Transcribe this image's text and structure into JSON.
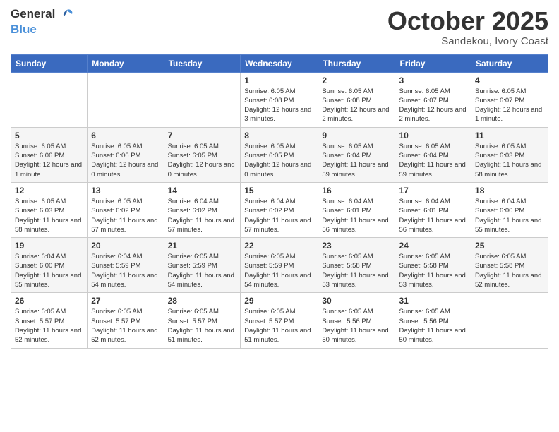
{
  "header": {
    "logo_general": "General",
    "logo_blue": "Blue",
    "month": "October 2025",
    "location": "Sandekou, Ivory Coast"
  },
  "weekdays": [
    "Sunday",
    "Monday",
    "Tuesday",
    "Wednesday",
    "Thursday",
    "Friday",
    "Saturday"
  ],
  "weeks": [
    [
      {
        "day": "",
        "info": ""
      },
      {
        "day": "",
        "info": ""
      },
      {
        "day": "",
        "info": ""
      },
      {
        "day": "1",
        "info": "Sunrise: 6:05 AM\nSunset: 6:08 PM\nDaylight: 12 hours and 3 minutes."
      },
      {
        "day": "2",
        "info": "Sunrise: 6:05 AM\nSunset: 6:08 PM\nDaylight: 12 hours and 2 minutes."
      },
      {
        "day": "3",
        "info": "Sunrise: 6:05 AM\nSunset: 6:07 PM\nDaylight: 12 hours and 2 minutes."
      },
      {
        "day": "4",
        "info": "Sunrise: 6:05 AM\nSunset: 6:07 PM\nDaylight: 12 hours and 1 minute."
      }
    ],
    [
      {
        "day": "5",
        "info": "Sunrise: 6:05 AM\nSunset: 6:06 PM\nDaylight: 12 hours and 1 minute."
      },
      {
        "day": "6",
        "info": "Sunrise: 6:05 AM\nSunset: 6:06 PM\nDaylight: 12 hours and 0 minutes."
      },
      {
        "day": "7",
        "info": "Sunrise: 6:05 AM\nSunset: 6:05 PM\nDaylight: 12 hours and 0 minutes."
      },
      {
        "day": "8",
        "info": "Sunrise: 6:05 AM\nSunset: 6:05 PM\nDaylight: 12 hours and 0 minutes."
      },
      {
        "day": "9",
        "info": "Sunrise: 6:05 AM\nSunset: 6:04 PM\nDaylight: 11 hours and 59 minutes."
      },
      {
        "day": "10",
        "info": "Sunrise: 6:05 AM\nSunset: 6:04 PM\nDaylight: 11 hours and 59 minutes."
      },
      {
        "day": "11",
        "info": "Sunrise: 6:05 AM\nSunset: 6:03 PM\nDaylight: 11 hours and 58 minutes."
      }
    ],
    [
      {
        "day": "12",
        "info": "Sunrise: 6:05 AM\nSunset: 6:03 PM\nDaylight: 11 hours and 58 minutes."
      },
      {
        "day": "13",
        "info": "Sunrise: 6:05 AM\nSunset: 6:02 PM\nDaylight: 11 hours and 57 minutes."
      },
      {
        "day": "14",
        "info": "Sunrise: 6:04 AM\nSunset: 6:02 PM\nDaylight: 11 hours and 57 minutes."
      },
      {
        "day": "15",
        "info": "Sunrise: 6:04 AM\nSunset: 6:02 PM\nDaylight: 11 hours and 57 minutes."
      },
      {
        "day": "16",
        "info": "Sunrise: 6:04 AM\nSunset: 6:01 PM\nDaylight: 11 hours and 56 minutes."
      },
      {
        "day": "17",
        "info": "Sunrise: 6:04 AM\nSunset: 6:01 PM\nDaylight: 11 hours and 56 minutes."
      },
      {
        "day": "18",
        "info": "Sunrise: 6:04 AM\nSunset: 6:00 PM\nDaylight: 11 hours and 55 minutes."
      }
    ],
    [
      {
        "day": "19",
        "info": "Sunrise: 6:04 AM\nSunset: 6:00 PM\nDaylight: 11 hours and 55 minutes."
      },
      {
        "day": "20",
        "info": "Sunrise: 6:04 AM\nSunset: 5:59 PM\nDaylight: 11 hours and 54 minutes."
      },
      {
        "day": "21",
        "info": "Sunrise: 6:05 AM\nSunset: 5:59 PM\nDaylight: 11 hours and 54 minutes."
      },
      {
        "day": "22",
        "info": "Sunrise: 6:05 AM\nSunset: 5:59 PM\nDaylight: 11 hours and 54 minutes."
      },
      {
        "day": "23",
        "info": "Sunrise: 6:05 AM\nSunset: 5:58 PM\nDaylight: 11 hours and 53 minutes."
      },
      {
        "day": "24",
        "info": "Sunrise: 6:05 AM\nSunset: 5:58 PM\nDaylight: 11 hours and 53 minutes."
      },
      {
        "day": "25",
        "info": "Sunrise: 6:05 AM\nSunset: 5:58 PM\nDaylight: 11 hours and 52 minutes."
      }
    ],
    [
      {
        "day": "26",
        "info": "Sunrise: 6:05 AM\nSunset: 5:57 PM\nDaylight: 11 hours and 52 minutes."
      },
      {
        "day": "27",
        "info": "Sunrise: 6:05 AM\nSunset: 5:57 PM\nDaylight: 11 hours and 52 minutes."
      },
      {
        "day": "28",
        "info": "Sunrise: 6:05 AM\nSunset: 5:57 PM\nDaylight: 11 hours and 51 minutes."
      },
      {
        "day": "29",
        "info": "Sunrise: 6:05 AM\nSunset: 5:57 PM\nDaylight: 11 hours and 51 minutes."
      },
      {
        "day": "30",
        "info": "Sunrise: 6:05 AM\nSunset: 5:56 PM\nDaylight: 11 hours and 50 minutes."
      },
      {
        "day": "31",
        "info": "Sunrise: 6:05 AM\nSunset: 5:56 PM\nDaylight: 11 hours and 50 minutes."
      },
      {
        "day": "",
        "info": ""
      }
    ]
  ]
}
